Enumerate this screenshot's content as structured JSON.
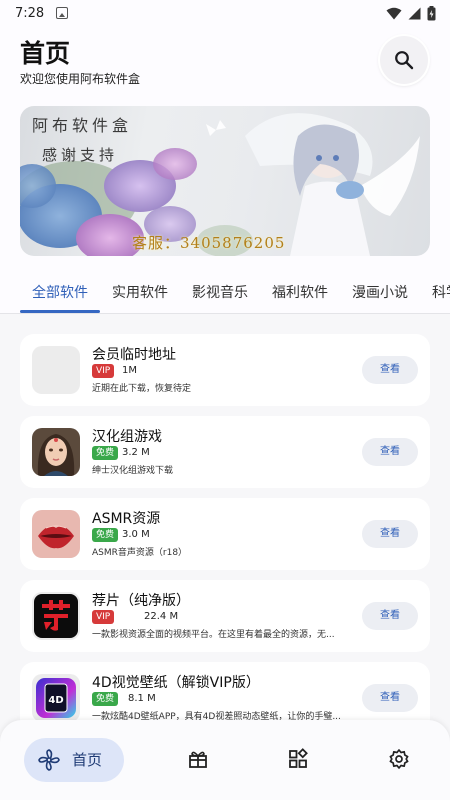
{
  "status_bar": {
    "time": "7:28"
  },
  "header": {
    "title": "首页",
    "subtitle": "欢迎您使用阿布软件盒"
  },
  "banner": {
    "line1": "阿布软件盒",
    "line2": "感谢支持",
    "qq": "客服：3405876205"
  },
  "tabs": [
    {
      "label": "全部软件",
      "active": true
    },
    {
      "label": "实用软件",
      "active": false
    },
    {
      "label": "影视音乐",
      "active": false
    },
    {
      "label": "福利软件",
      "active": false
    },
    {
      "label": "漫画小说",
      "active": false
    },
    {
      "label": "科学",
      "active": false
    }
  ],
  "apps": [
    {
      "name": "会员临时地址",
      "tag": "VIP",
      "size": "1M",
      "desc": "近期在此下载，恢复待定",
      "button": "查看",
      "icon": "blank-app-icon"
    },
    {
      "name": "汉化组游戏",
      "tag": "免费",
      "size": "3.2 M",
      "desc": "绅士汉化组游戏下载",
      "button": "查看",
      "icon": "anime-girl-app-icon"
    },
    {
      "name": "ASMR资源",
      "tag": "免费",
      "size": "3.0 M",
      "desc": "ASMR音声资源（r18）",
      "button": "查看",
      "icon": "lips-app-icon"
    },
    {
      "name": "荐片（纯净版）",
      "tag": "VIP",
      "size": "22.4 M",
      "desc": "一款影视资源全面的视频平台。在这里有着最全的资源，无...",
      "button": "查看",
      "icon": "jianpian-app-icon"
    },
    {
      "name": "4D视觉壁纸（解锁VIP版）",
      "tag": "免费",
      "size": "8.1 M",
      "desc": "一款炫酷4D壁纸APP，具有4D视差照动态壁纸，让你的手璧...",
      "button": "查看",
      "icon": "4d-wallpaper-app-icon"
    }
  ],
  "bottom_nav": {
    "home_label": "首页",
    "items": [
      "home-icon",
      "gift-icon",
      "apps-grid-icon",
      "settings-gear-icon"
    ]
  },
  "colors": {
    "accent": "#3567c2",
    "vip_tag": "#d63a3a",
    "free_tag": "#3aa84a",
    "nav_active_bg": "#dde5f8"
  }
}
